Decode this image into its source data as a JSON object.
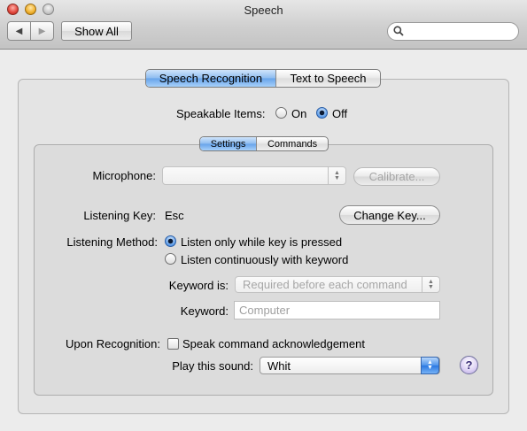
{
  "window": {
    "title": "Speech"
  },
  "toolbar": {
    "back_icon": "back-arrow-icon",
    "forward_icon": "forward-arrow-icon",
    "show_all_label": "Show All",
    "search_value": ""
  },
  "main_tabs": [
    {
      "label": "Speech Recognition",
      "selected": true
    },
    {
      "label": "Text to Speech",
      "selected": false
    }
  ],
  "speakable_items": {
    "label": "Speakable Items:",
    "options": [
      {
        "label": "On",
        "selected": false
      },
      {
        "label": "Off",
        "selected": true
      }
    ]
  },
  "sub_tabs": [
    {
      "label": "Settings",
      "selected": true
    },
    {
      "label": "Commands",
      "selected": false
    }
  ],
  "settings": {
    "microphone_label": "Microphone:",
    "microphone_value": "",
    "calibrate_label": "Calibrate...",
    "listening_key_label": "Listening Key:",
    "listening_key_value": "Esc",
    "change_key_label": "Change Key...",
    "listening_method_label": "Listening Method:",
    "listening_methods": [
      {
        "label": "Listen only while key is pressed",
        "selected": true
      },
      {
        "label": "Listen continuously with keyword",
        "selected": false
      }
    ],
    "keyword_is_label": "Keyword is:",
    "keyword_is_value": "Required before each command",
    "keyword_label": "Keyword:",
    "keyword_value": "Computer",
    "upon_recognition_label": "Upon Recognition:",
    "speak_ack_label": "Speak command acknowledgement",
    "speak_ack_checked": false,
    "play_sound_label": "Play this sound:",
    "play_sound_value": "Whit",
    "help_label": "?"
  },
  "colors": {
    "selected_tab": "#66a3ea",
    "window_bg": "#ececec"
  }
}
